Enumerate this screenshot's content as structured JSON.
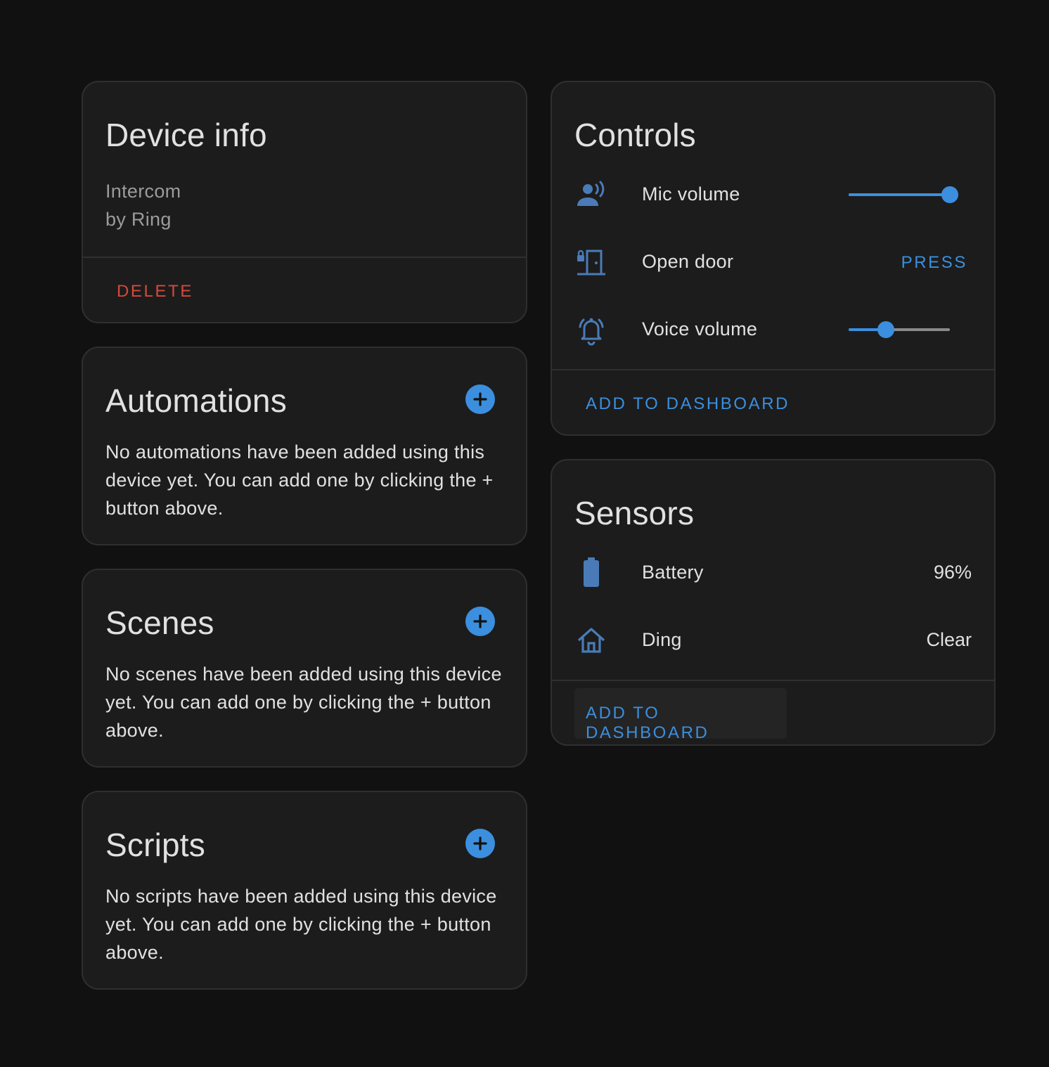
{
  "colors": {
    "background": "#111111",
    "card": "#1c1c1c",
    "accent": "#3b8fde",
    "danger": "#d5493c",
    "icon": "#4a7bb8"
  },
  "device_info": {
    "title": "Device info",
    "model": "Intercom",
    "manufacturer": "by Ring",
    "delete_label": "DELETE"
  },
  "automations": {
    "title": "Automations",
    "add_icon": "plus-circle-icon",
    "empty_text": "No automations have been added using this device yet. You can add one by clicking the + button above."
  },
  "scenes": {
    "title": "Scenes",
    "add_icon": "plus-circle-icon",
    "empty_text": "No scenes have been added using this device yet. You can add one by clicking the + button above."
  },
  "scripts": {
    "title": "Scripts",
    "add_icon": "plus-circle-icon",
    "empty_text": "No scripts have been added using this device yet. You can add one by clicking the + button above."
  },
  "controls": {
    "title": "Controls",
    "items": [
      {
        "icon": "account-voice-icon",
        "label": "Mic volume",
        "type": "slider",
        "value": 1.0
      },
      {
        "icon": "door-lock-icon",
        "label": "Open door",
        "type": "button",
        "action_label": "PRESS"
      },
      {
        "icon": "bell-ring-icon",
        "label": "Voice volume",
        "type": "slider",
        "value": 0.37
      }
    ],
    "add_to_dashboard_label": "ADD TO DASHBOARD"
  },
  "sensors": {
    "title": "Sensors",
    "items": [
      {
        "icon": "battery-icon",
        "label": "Battery",
        "value": "96%"
      },
      {
        "icon": "home-outline-icon",
        "label": "Ding",
        "value": "Clear"
      }
    ],
    "add_to_dashboard_label": "ADD TO DASHBOARD"
  }
}
